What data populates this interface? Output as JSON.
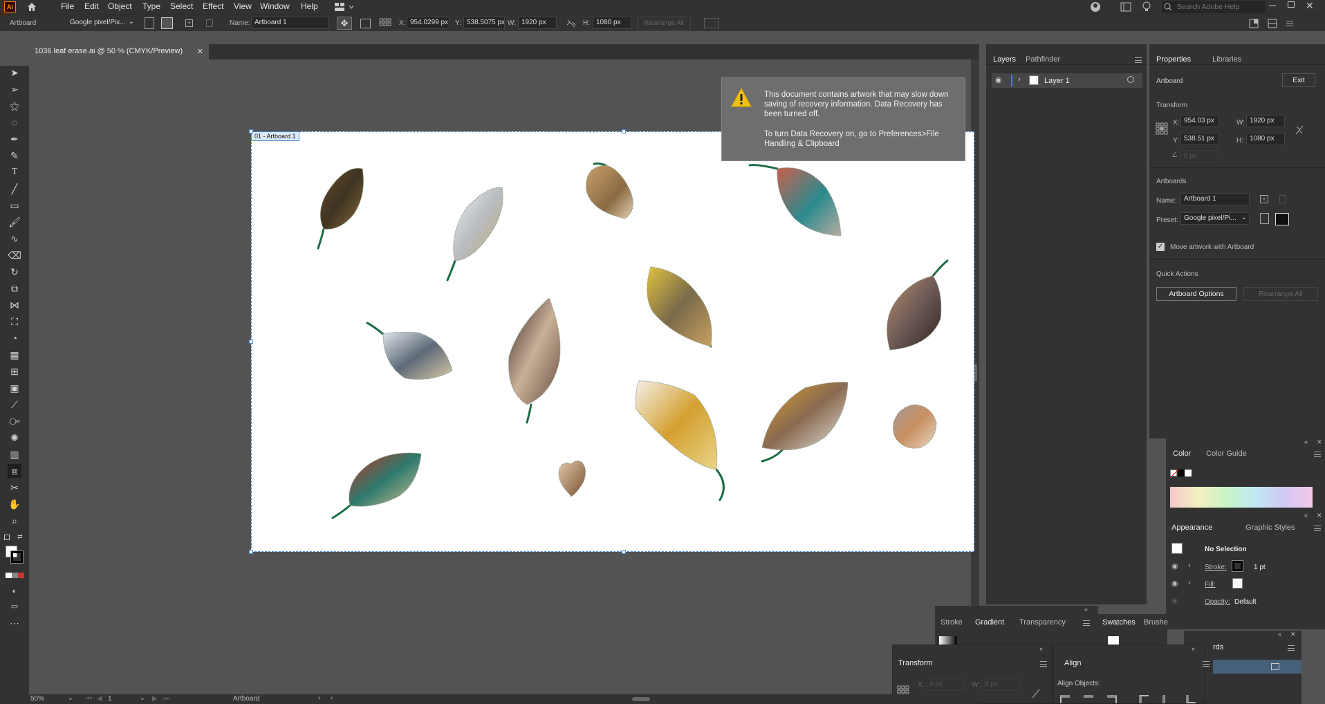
{
  "app": {
    "logo": "Ai"
  },
  "menu": [
    "File",
    "Edit",
    "Object",
    "Type",
    "Select",
    "Effect",
    "View",
    "Window",
    "Help"
  ],
  "search": {
    "placeholder": "Search Adobe Help"
  },
  "control": {
    "context": "Artboard",
    "preset": "Google pixel/Pix...",
    "name_label": "Name:",
    "name_value": "Artboard 1",
    "x_label": "X:",
    "x_value": "954.0299 px",
    "y_label": "Y:",
    "y_value": "538.5075 px",
    "w_label": "W:",
    "w_value": "1920 px",
    "h_label": "H:",
    "h_value": "1080 px",
    "rearrange": "Rearrange All"
  },
  "document": {
    "tab_title": "1036 leaf erase.ai @ 50 % (CMYK/Preview)",
    "artboard_label": "01 - Artboard 1"
  },
  "notice": {
    "line1": "This document contains artwork that may slow down saving of recovery information. Data Recovery has been turned off.",
    "line2": "To turn Data Recovery on, go to Preferences>File Handling & Clipboard"
  },
  "layers_panel": {
    "tabs": [
      "Layers",
      "Pathfinder"
    ],
    "layer_name": "Layer 1"
  },
  "properties": {
    "tabs": [
      "Properties",
      "Libraries"
    ],
    "context": "Artboard",
    "exit": "Exit",
    "transform_title": "Transform",
    "x_label": "X:",
    "x": "954.03 px",
    "y_label": "Y:",
    "y": "538.51 px",
    "w_label": "W:",
    "w": "1920 px",
    "h_label": "H:",
    "h": "1080 px",
    "angle": "0 px",
    "artboards_title": "Artboards",
    "name_label": "Name:",
    "name": "Artboard 1",
    "preset_label": "Preset:",
    "preset": "Google pixel/Pi...",
    "move_artwork": "Move artwork with Artboard",
    "quick_actions": "Quick Actions",
    "artboard_options": "Artboard Options",
    "rearrange_all": "Rearrange All"
  },
  "color_panel": {
    "tabs": [
      "Color",
      "Color Guide"
    ]
  },
  "appearance_panel": {
    "tabs": [
      "Appearance",
      "Graphic Styles"
    ],
    "no_selection": "No Selection",
    "stroke_label": "Stroke:",
    "stroke_value": "1 pt",
    "fill_label": "Fill:",
    "opacity_label": "Opacity:",
    "opacity_value": "Default"
  },
  "gradient_panel": {
    "tabs": [
      "Stroke",
      "Gradient",
      "Transparency"
    ]
  },
  "swatches_panel": {
    "tabs": [
      "Swatches",
      "Brushe"
    ]
  },
  "transform_panel": {
    "title": "Transform",
    "x_label": "X:",
    "x": "0 px",
    "w_label": "W:",
    "w": "0 px"
  },
  "align_panel": {
    "title": "Align",
    "align_objects": "Align Objects:"
  },
  "artboards_float": {
    "title": "rds"
  },
  "status": {
    "zoom": "50%",
    "page": "1",
    "tool": "Artboard"
  }
}
